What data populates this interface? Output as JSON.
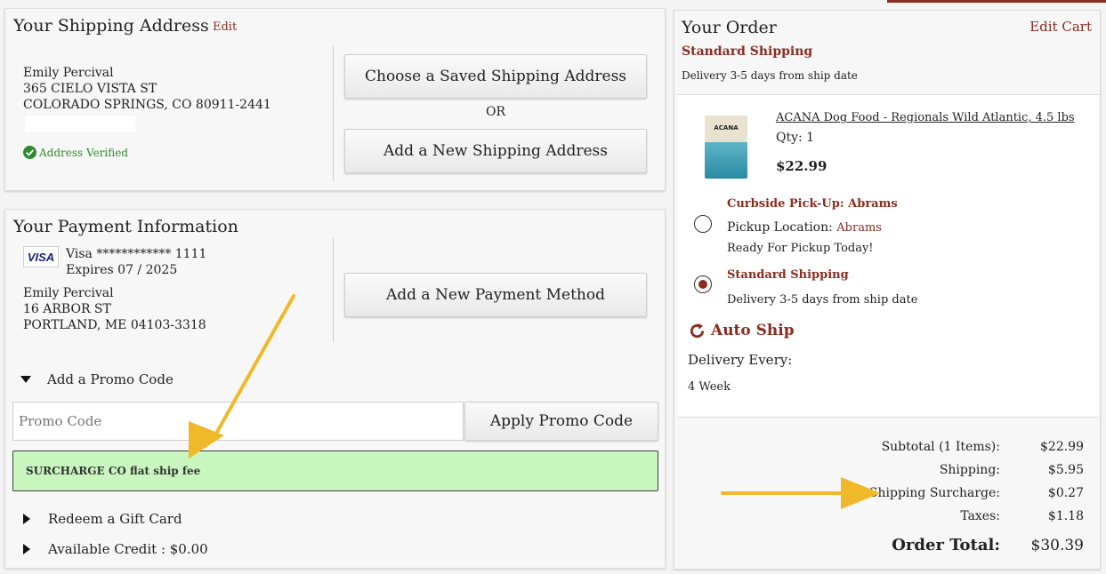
{
  "shipping": {
    "title": "Your Shipping Address",
    "edit_label": "Edit",
    "name": "Emily Percival",
    "street": "365 CIELO VISTA ST",
    "city_line": "COLORADO SPRINGS, CO 80911-2441",
    "verified_label": "Address Verified",
    "saved_button": "Choose a Saved Shipping Address",
    "or_label": "OR",
    "new_button": "Add a New Shipping Address"
  },
  "payment": {
    "title": "Your Payment Information",
    "card_brand_badge": "VISA",
    "card_line": "Visa ************ 1111",
    "expires": "Expires 07 / 2025",
    "name": "Emily Percival",
    "street": "16 ARBOR ST",
    "city_line": "PORTLAND, ME 04103-3318",
    "new_button": "Add a New Payment Method",
    "promo_toggle": "Add a Promo Code",
    "promo_placeholder": "Promo Code",
    "promo_button": "Apply Promo Code",
    "promo_message": "SURCHARGE CO flat ship fee",
    "gift_card": "Redeem a Gift Card",
    "credit": "Available Credit : $0.00"
  },
  "order": {
    "title": "Your Order",
    "edit_cart": "Edit Cart",
    "shipping_method": "Standard Shipping",
    "delivery_note": "Delivery 3-5 days from ship date",
    "product": {
      "name": "ACANA Dog Food - Regionals Wild Atlantic, 4.5 lbs",
      "qty": "Qty: 1",
      "price": "$22.99",
      "bag_label": "ACANA"
    },
    "options": {
      "curbside_title": "Curbside Pick-Up: Abrams",
      "pickup_label": "Pickup Location:",
      "pickup_value": "Abrams",
      "ready": "Ready For Pickup Today!",
      "standard_title": "Standard Shipping",
      "standard_note": "Delivery 3-5 days from ship date"
    },
    "autoship": {
      "title": "Auto Ship",
      "delivery_every": "Delivery Every:",
      "frequency": "4 Week"
    },
    "summary": {
      "subtotal_label": "Subtotal (1 Items):",
      "subtotal_value": "$22.99",
      "shipping_label": "Shipping:",
      "shipping_value": "$5.95",
      "surcharge_label": "Shipping Surcharge:",
      "surcharge_value": "$0.27",
      "taxes_label": "Taxes:",
      "taxes_value": "$1.18",
      "total_label": "Order Total:",
      "total_value": "$30.39"
    }
  },
  "colors": {
    "accent": "#8b2c20",
    "verified_green": "#2e8b2e",
    "promo_bg": "#c9f5bf",
    "annotation_arrow": "#f0b92a"
  }
}
